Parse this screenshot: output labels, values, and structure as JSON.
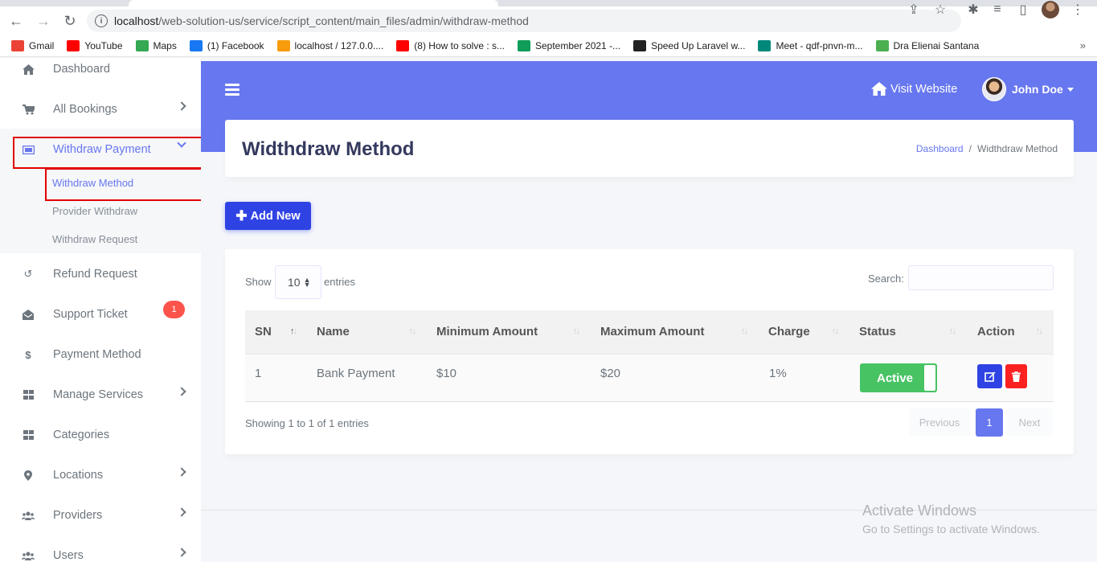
{
  "browser": {
    "url_host": "localhost",
    "url_path": "/web-solution-us/service/script_content/main_files/admin/withdraw-method",
    "bookmarks": [
      {
        "label": "Gmail",
        "icon": "gmail-icon",
        "color": "#ea4335"
      },
      {
        "label": "YouTube",
        "icon": "youtube-icon",
        "color": "#ff0000"
      },
      {
        "label": "Maps",
        "icon": "maps-icon",
        "color": "#34a853"
      },
      {
        "label": "(1) Facebook",
        "icon": "facebook-icon",
        "color": "#1877f2"
      },
      {
        "label": "localhost / 127.0.0....",
        "icon": "phpmyadmin-icon",
        "color": "#f89c0e"
      },
      {
        "label": "(8) How to solve : s...",
        "icon": "youtube-icon",
        "color": "#ff0000"
      },
      {
        "label": "September 2021 -...",
        "icon": "sheets-icon",
        "color": "#0f9d58"
      },
      {
        "label": "Speed Up Laravel w...",
        "icon": "laravel-icon",
        "color": "#222222"
      },
      {
        "label": "Meet - qdf-pnvn-m...",
        "icon": "meet-icon",
        "color": "#00897b"
      },
      {
        "label": "Dra Elienai Santana",
        "icon": "site-icon",
        "color": "#4caf50"
      }
    ],
    "more": "»"
  },
  "sidebar": {
    "dashboard": "Dashboard",
    "all_bookings": "All Bookings",
    "withdraw_payment": "Withdraw Payment",
    "withdraw_method": "Withdraw Method",
    "provider_withdraw": "Provider Withdraw",
    "withdraw_request": "Withdraw Request",
    "refund_request": "Refund Request",
    "support_ticket": "Support Ticket",
    "support_badge": "1",
    "payment_method": "Payment Method",
    "manage_services": "Manage Services",
    "categories": "Categories",
    "locations": "Locations",
    "providers": "Providers",
    "users": "Users"
  },
  "topbar": {
    "visit_website": "Visit Website",
    "user_name": "John Doe"
  },
  "header": {
    "title": "Widthdraw Method",
    "crumb_home": "Dashboard",
    "crumb_sep": "/",
    "crumb_current": "Widthdraw Method"
  },
  "add_button": "Add New",
  "table_controls": {
    "show": "Show",
    "length": "10",
    "entries": "entries",
    "search_label": "Search:"
  },
  "table": {
    "headers": [
      "SN",
      "Name",
      "Minimum Amount",
      "Maximum Amount",
      "Charge",
      "Status",
      "Action"
    ],
    "rows": [
      {
        "sn": "1",
        "name": "Bank Payment",
        "min": "$10",
        "max": "$20",
        "charge": "1%",
        "status": "Active"
      }
    ]
  },
  "footer_info": "Showing 1 to 1 of 1 entries",
  "pagination": {
    "previous": "Previous",
    "page": "1",
    "next": "Next"
  },
  "watermark": {
    "line1": "Activate Windows",
    "line2": "Go to Settings to activate Windows."
  },
  "colors": {
    "primary": "#6777ef",
    "success": "#47c363",
    "danger": "#fc2222",
    "highlight": "#e10000"
  }
}
